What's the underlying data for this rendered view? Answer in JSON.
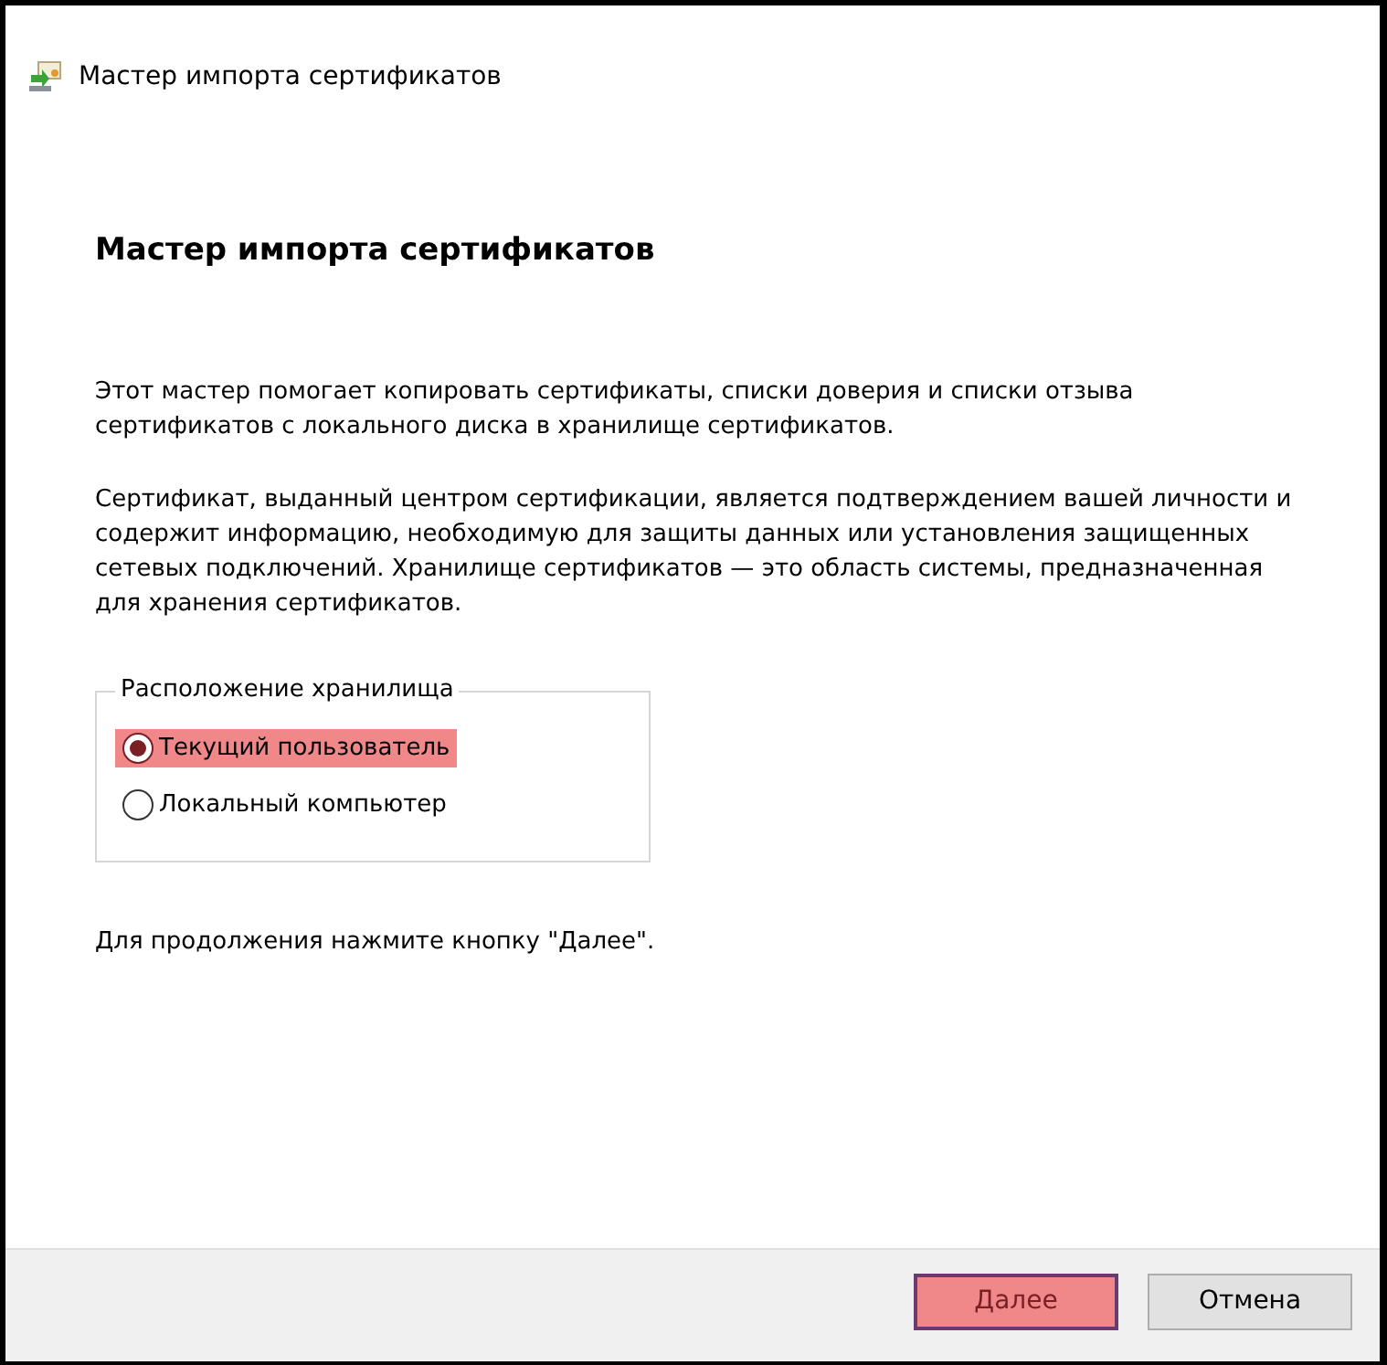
{
  "window": {
    "title": "Мастер импорта сертификатов"
  },
  "heading": "Мастер импорта сертификатов",
  "paragraphs": [
    "Этот мастер помогает копировать сертификаты, списки доверия и списки отзыва сертификатов с локального диска в хранилище сертификатов.",
    "Сертификат, выданный центром сертификации, является подтверждением вашей личности и содержит информацию, необходимую для защиты данных или установления защищенных сетевых подключений. Хранилище сертификатов — это область системы, предназначенная для хранения сертификатов."
  ],
  "store_location": {
    "legend": "Расположение хранилища",
    "options": [
      {
        "label": "Текущий пользователь",
        "selected": true,
        "highlighted": true
      },
      {
        "label": "Локальный компьютер",
        "selected": false,
        "highlighted": false
      }
    ]
  },
  "hint": "Для продолжения нажмите кнопку \"Далее\".",
  "buttons": [
    {
      "label": "Далее",
      "highlighted": true
    },
    {
      "label": "Отмена",
      "highlighted": false
    }
  ]
}
